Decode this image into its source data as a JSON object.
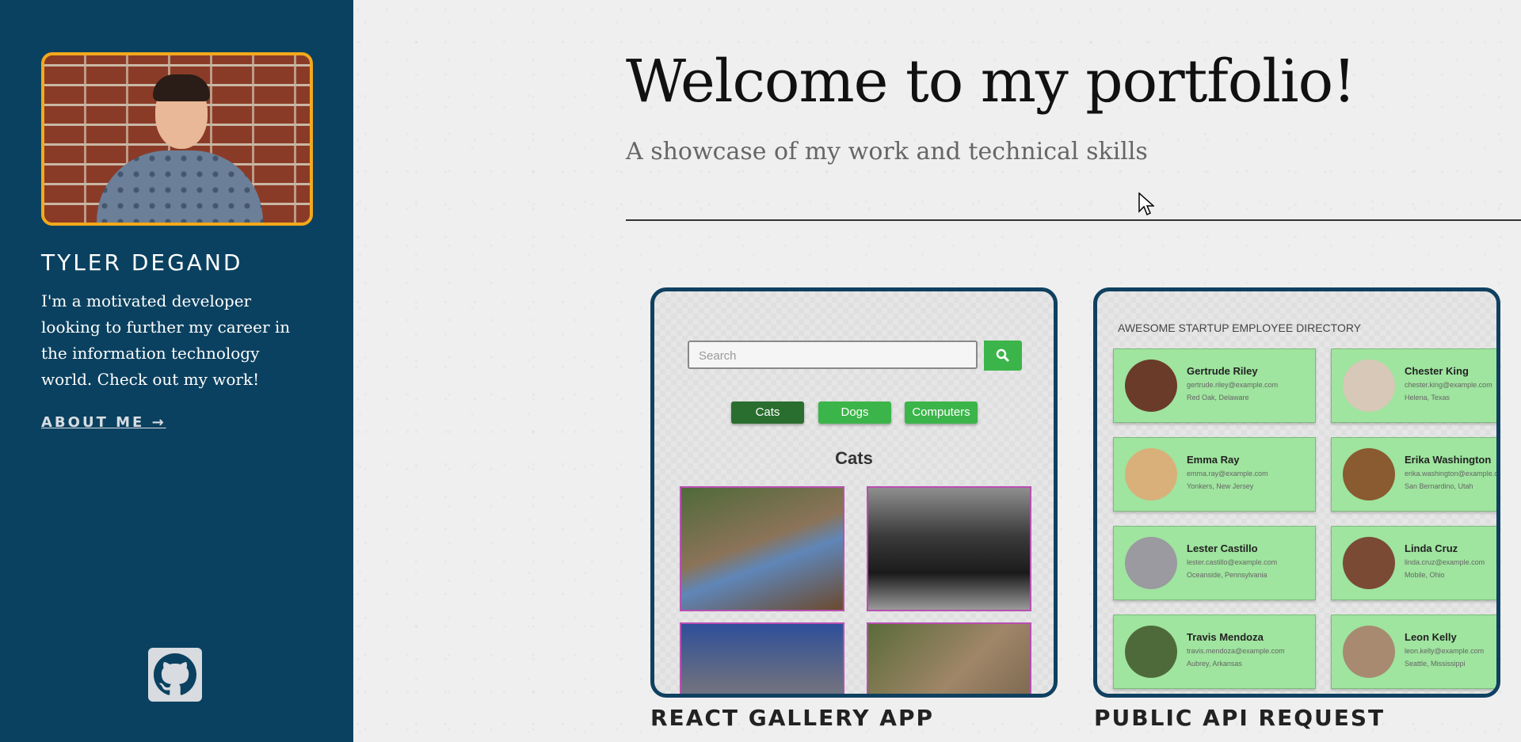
{
  "sidebar": {
    "name": "TYLER DEGAND",
    "bio": "I'm a motivated developer looking to further my career in the information technology world. Check out my work!",
    "about_link": "ABOUT ME →",
    "accent_color": "#f3a91b",
    "background_color": "#0b4160",
    "github_icon": "github-icon"
  },
  "main": {
    "title": "Welcome to my portfolio!",
    "subtitle": "A showcase of my work and technical skills"
  },
  "projects": [
    {
      "title": "REACT GALLERY APP",
      "preview": {
        "search_placeholder": "Search",
        "nav": [
          "Cats",
          "Dogs",
          "Computers"
        ],
        "heading": "Cats"
      }
    },
    {
      "title": "PUBLIC API REQUEST",
      "preview": {
        "heading": "AWESOME STARTUP EMPLOYEE DIRECTORY",
        "employees": [
          {
            "name": "Gertrude Riley",
            "email": "gertrude.riley@example.com",
            "location": "Red Oak, Delaware"
          },
          {
            "name": "Chester King",
            "email": "chester.king@example.com",
            "location": "Helena, Texas"
          },
          {
            "name": "Emma Ray",
            "email": "emma.ray@example.com",
            "location": "Yonkers, New Jersey"
          },
          {
            "name": "Erika Washington",
            "email": "erika.washington@example.com",
            "location": "San Bernardino, Utah"
          },
          {
            "name": "Lester Castillo",
            "email": "lester.castillo@example.com",
            "location": "Oceanside, Pennsylvania"
          },
          {
            "name": "Linda Cruz",
            "email": "linda.cruz@example.com",
            "location": "Mobile, Ohio"
          },
          {
            "name": "Travis Mendoza",
            "email": "travis.mendoza@example.com",
            "location": "Aubrey, Arkansas"
          },
          {
            "name": "Leon Kelly",
            "email": "leon.kelly@example.com",
            "location": "Seattle, Mississippi"
          }
        ]
      }
    }
  ]
}
